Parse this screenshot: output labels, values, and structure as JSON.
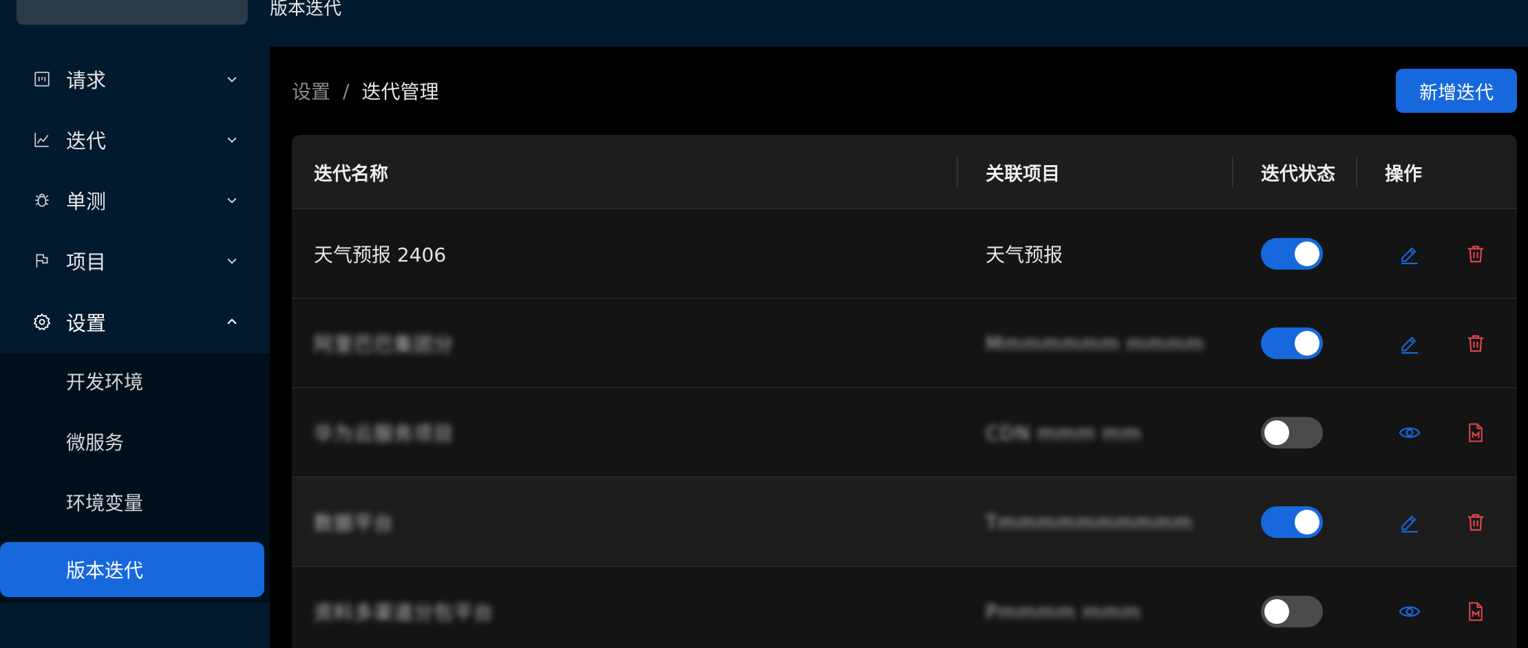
{
  "header": {
    "title": "版本迭代"
  },
  "sidebar": {
    "items": [
      {
        "label": "请求",
        "icon": "request-icon"
      },
      {
        "label": "迭代",
        "icon": "chart-line-icon"
      },
      {
        "label": "单测",
        "icon": "bug-icon"
      },
      {
        "label": "项目",
        "icon": "flag-icon"
      },
      {
        "label": "设置",
        "icon": "gear-icon"
      }
    ],
    "submenu": [
      {
        "label": "开发环境"
      },
      {
        "label": "微服务"
      },
      {
        "label": "环境变量"
      },
      {
        "label": "版本迭代",
        "active": true
      }
    ]
  },
  "breadcrumb": {
    "parent": "设置",
    "separator": "/",
    "current": "迭代管理"
  },
  "toolbar": {
    "add_label": "新增迭代"
  },
  "table": {
    "columns": [
      "迭代名称",
      "关联项目",
      "迭代状态",
      "操作"
    ],
    "rows": [
      {
        "name": "天气预报 2406",
        "project": "天气预报",
        "enabled": true,
        "actions": [
          "edit",
          "delete"
        ],
        "blurred": false
      },
      {
        "name": "",
        "project": "",
        "enabled": true,
        "actions": [
          "edit",
          "delete"
        ],
        "blurred": true
      },
      {
        "name": "",
        "project": "",
        "enabled": false,
        "actions": [
          "view",
          "markdown"
        ],
        "blurred": true
      },
      {
        "name": "",
        "project": "",
        "enabled": true,
        "actions": [
          "edit",
          "delete"
        ],
        "blurred": true
      },
      {
        "name": "",
        "project": "",
        "enabled": false,
        "actions": [
          "view",
          "markdown"
        ],
        "blurred": true
      }
    ]
  },
  "colors": {
    "accent": "#1668dc",
    "danger": "#e5484d",
    "sidebar_bg": "#011a2e",
    "main_bg": "#000000"
  }
}
